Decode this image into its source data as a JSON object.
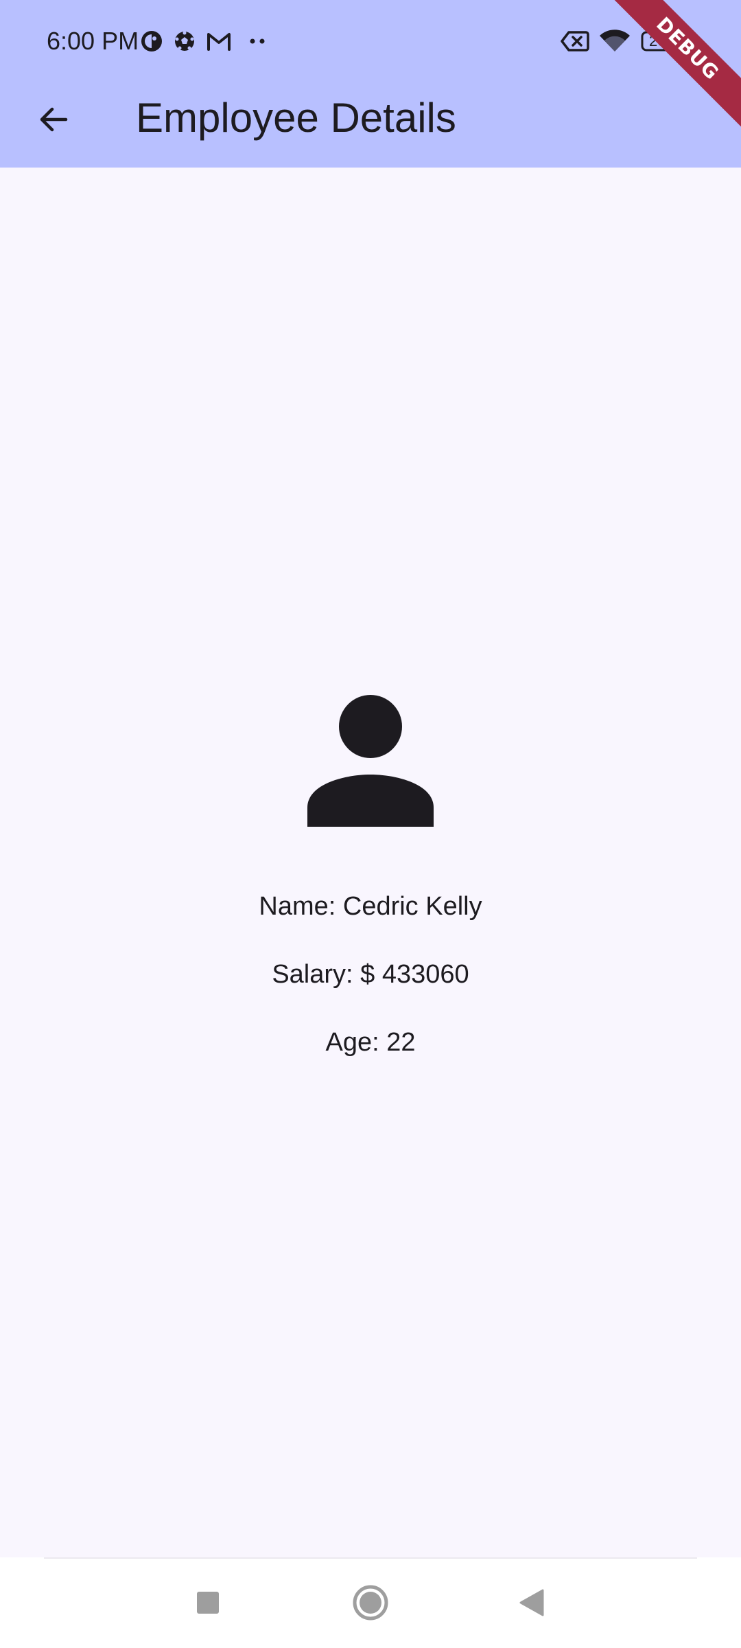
{
  "status_bar": {
    "time": "6:00 PM",
    "battery_level": "20",
    "icons": [
      "app-notification-icon",
      "soccer-ball-icon",
      "gmail-icon",
      "more-notifications-icon",
      "no-sim-icon",
      "wifi-icon",
      "battery-icon"
    ]
  },
  "app_bar": {
    "title": "Employee Details",
    "back_icon": "arrow-back-icon"
  },
  "debug_banner": "DEBUG",
  "employee": {
    "avatar_icon": "person-icon",
    "name_line": "Name: Cedric Kelly",
    "salary_line": "Salary: $ 433060",
    "age_line": "Age: 22"
  },
  "nav_bar": {
    "recents_icon": "square-recents-icon",
    "home_icon": "circle-home-icon",
    "back_icon": "triangle-back-icon"
  },
  "colors": {
    "app_bar": "#B8C0FF",
    "background": "#F9F6FE",
    "text": "#1D1B20",
    "debug_ribbon": "#A52A43"
  }
}
